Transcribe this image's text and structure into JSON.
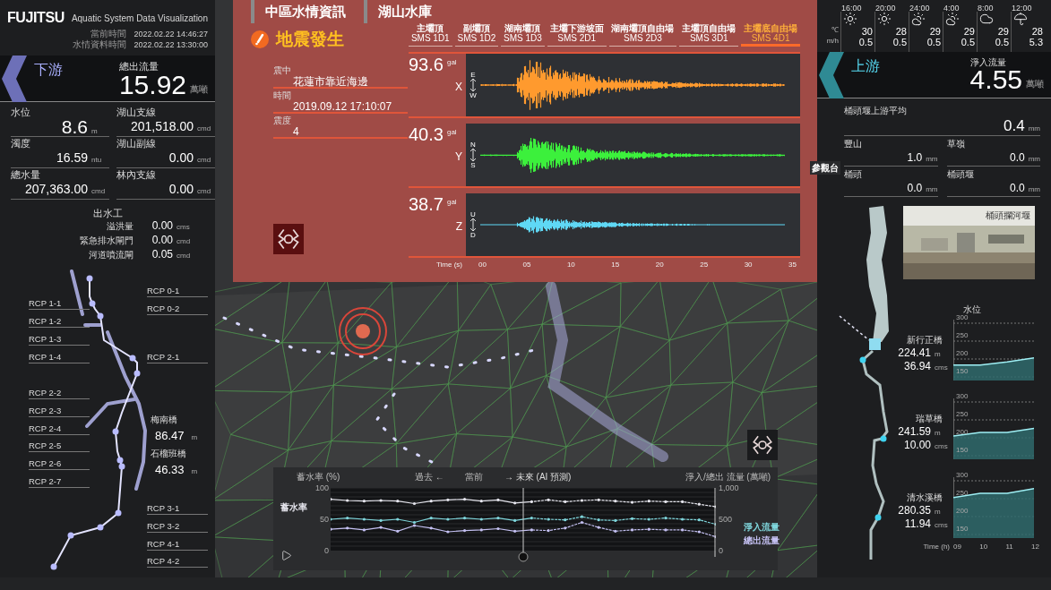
{
  "header": {
    "brand": "FUJITSU",
    "title": "Aquatic System Data Visualization",
    "times": [
      {
        "label": "當前時間",
        "value": "2022.02.22 14:46:27"
      },
      {
        "label": "水情資料時間",
        "value": "2022.02.22 13:30:00"
      }
    ]
  },
  "downstream": {
    "label": "下游",
    "metric_label": "總出流量",
    "value": "15.92",
    "unit": "萬噸",
    "stats": [
      {
        "label": "水位",
        "value": "8.6",
        "unit": "m",
        "large": true
      },
      {
        "label": "湖山支線",
        "value": "201,518.00",
        "unit": "cmd",
        "large": false
      },
      {
        "label": "濁度",
        "value": "16.59",
        "unit": "ntu",
        "large": false
      },
      {
        "label": "湖山副線",
        "value": "0.00",
        "unit": "cmd",
        "large": false
      },
      {
        "label": "總水量",
        "value": "207,363.00",
        "unit": "cmd",
        "large": false
      },
      {
        "label": "林內支線",
        "value": "0.00",
        "unit": "cmd",
        "large": false
      }
    ],
    "outlet": {
      "title": "出水工",
      "rows": [
        {
          "label": "溢洪量",
          "value": "0.00",
          "unit": "cms"
        },
        {
          "label": "緊急排水閘門",
          "value": "0.00",
          "unit": "cmd"
        },
        {
          "label": "河道噴流閘",
          "value": "0.05",
          "unit": "cmd"
        }
      ]
    },
    "river_points": [
      "RCP 0-1",
      "RCP 1-1",
      "RCP 0-2",
      "RCP 1-2",
      "RCP 1-3",
      "RCP 1-4",
      "RCP 2-1",
      "RCP 2-2",
      "RCP 2-3",
      "RCP 2-4",
      "RCP 2-5",
      "RCP 2-6",
      "RCP 2-7",
      "RCP 3-1",
      "RCP 3-2",
      "RCP 4-1",
      "RCP 4-2"
    ],
    "bridges": [
      {
        "name": "梅南橋",
        "value": "86.47",
        "unit": "m"
      },
      {
        "name": "石榴班橋",
        "value": "46.33",
        "unit": "m"
      }
    ]
  },
  "alert_panel": {
    "tabs": [
      "中區水情資訊",
      "湖山水庫"
    ],
    "alert": "地震發生",
    "fields": [
      {
        "label": "震中",
        "value": "花蓮市靠近海邊"
      },
      {
        "label": "時間",
        "value": "2019.09.12 17:10:07"
      },
      {
        "label": "震度",
        "value": "4"
      }
    ],
    "sensors": [
      {
        "name": "主壩頂",
        "code": "SMS 1D1",
        "selected": false
      },
      {
        "name": "副壩頂",
        "code": "SMS 1D2",
        "selected": false
      },
      {
        "name": "湖南壩頂",
        "code": "SMS 1D3",
        "selected": false
      },
      {
        "name": "主壩下游坡面",
        "code": "SMS 2D1",
        "selected": false
      },
      {
        "name": "湖南壩頂自由場",
        "code": "SMS 2D3",
        "selected": false
      },
      {
        "name": "主壩頂自由場",
        "code": "SMS 3D1",
        "selected": false
      },
      {
        "name": "主壩底自由場",
        "code": "SMS 4D1",
        "selected": true
      }
    ],
    "channels": [
      {
        "value": "93.6",
        "unit": "gal",
        "axis": "X",
        "top": "E",
        "bottom": "W",
        "color": "#ff9a2e"
      },
      {
        "value": "40.3",
        "unit": "gal",
        "axis": "Y",
        "top": "N",
        "bottom": "S",
        "color": "#3cf03c"
      },
      {
        "value": "38.7",
        "unit": "gal",
        "axis": "Z",
        "top": "U",
        "bottom": "D",
        "color": "#5fd8f5"
      }
    ],
    "time_axis": {
      "label": "Time (s)",
      "ticks": [
        "00",
        "05",
        "10",
        "15",
        "20",
        "25",
        "30",
        "35"
      ]
    }
  },
  "trend_panel": {
    "left_title": "蓄水率 (%)",
    "past": "過去 ←",
    "now": "當前",
    "future": "→ 未來 (AI 預測)",
    "right_title": "淨入/總出 流量 (萬噸)",
    "right_ticks": [
      "1,000",
      "500",
      "0"
    ],
    "timeline": {
      "level": 0.5
    },
    "chart_data": {
      "type": "line",
      "grid": true,
      "yticks": [
        {
          "value": 0,
          "label": "0"
        },
        {
          "value": 50,
          "label": "50"
        },
        {
          "value": 100,
          "label": "100"
        }
      ],
      "ylim": [
        0,
        100
      ],
      "series": [
        {
          "name": "蓄水率",
          "color": "#e6e6ee",
          "values": [
            82,
            80,
            79,
            80,
            79,
            75,
            79,
            81,
            82,
            79,
            81,
            76,
            78,
            81,
            78,
            80,
            81,
            79,
            77,
            79,
            78,
            78,
            74,
            70
          ]
        },
        {
          "name": "淨入流量",
          "color": "#7fd6dc",
          "values": [
            50,
            52,
            50,
            48,
            50,
            45,
            52,
            50,
            52,
            50,
            52,
            48,
            52,
            50,
            49,
            54,
            49,
            48,
            51,
            50,
            52,
            50,
            49,
            42
          ]
        },
        {
          "name": "總出流量",
          "color": "#c4c0f2",
          "values": [
            34,
            36,
            33,
            37,
            31,
            40,
            36,
            30,
            32,
            33,
            35,
            31,
            33,
            32,
            36,
            45,
            37,
            31,
            33,
            34,
            33,
            33,
            30,
            22
          ]
        }
      ]
    }
  },
  "weather": {
    "temp_unit": "℃",
    "rain_unit": "m/h",
    "hours": [
      {
        "time": "16:00",
        "kind": "sun",
        "temp": "30",
        "rain": "0.5"
      },
      {
        "time": "20:00",
        "kind": "sun",
        "temp": "28",
        "rain": "0.5"
      },
      {
        "time": "24:00",
        "kind": "partly",
        "temp": "29",
        "rain": "0.5"
      },
      {
        "time": "4:00",
        "kind": "partly",
        "temp": "29",
        "rain": "0.5"
      },
      {
        "time": "8:00",
        "kind": "cloud",
        "temp": "29",
        "rain": "0.5"
      },
      {
        "time": "12:00",
        "kind": "rain",
        "temp": "28",
        "rain": "5.3"
      }
    ]
  },
  "upstream": {
    "label": "上游",
    "metric_label": "淨入流量",
    "value": "4.55",
    "unit": "萬噸",
    "average": {
      "label": "桶頭堰上游平均",
      "value": "0.4",
      "unit": "mm"
    },
    "rain": [
      {
        "label": "豐山",
        "value": "1.0",
        "unit": "mm"
      },
      {
        "label": "草嶺",
        "value": "0.0",
        "unit": "mm"
      },
      {
        "label": "桶頭",
        "value": "0.0",
        "unit": "mm"
      },
      {
        "label": "桶頭堰",
        "value": "0.0",
        "unit": "mm"
      }
    ],
    "scene_label": "參觀台",
    "photo_caption": "桶頭攔河堰",
    "chart_title": "水位",
    "stations": [
      {
        "name": "新行正橋",
        "level": "224.41",
        "level_unit": "m",
        "flow": "36.94",
        "flow_unit": "cms",
        "chart_data": {
          "type": "area",
          "grid": true,
          "ylim": [
            140,
            310
          ],
          "yticks": [
            150,
            200,
            250,
            300
          ],
          "values": [
            183,
            183,
            192,
            203
          ]
        }
      },
      {
        "name": "瑞草橋",
        "level": "241.59",
        "level_unit": "m",
        "flow": "10.00",
        "flow_unit": "cms",
        "chart_data": {
          "type": "area",
          "grid": true,
          "ylim": [
            140,
            310
          ],
          "yticks": [
            150,
            200,
            250,
            300
          ],
          "values": [
            205,
            215,
            215,
            226
          ]
        }
      },
      {
        "name": "清水溪橋",
        "level": "280.35",
        "level_unit": "m",
        "flow": "11.94",
        "flow_unit": "cms",
        "chart_data": {
          "type": "area",
          "grid": true,
          "ylim": [
            140,
            310
          ],
          "yticks": [
            150,
            200,
            250,
            300
          ],
          "values": [
            253,
            265,
            265,
            278
          ]
        }
      }
    ],
    "time_axis": {
      "label": "Time (h)",
      "ticks": [
        "09",
        "10",
        "11",
        "12"
      ]
    }
  }
}
